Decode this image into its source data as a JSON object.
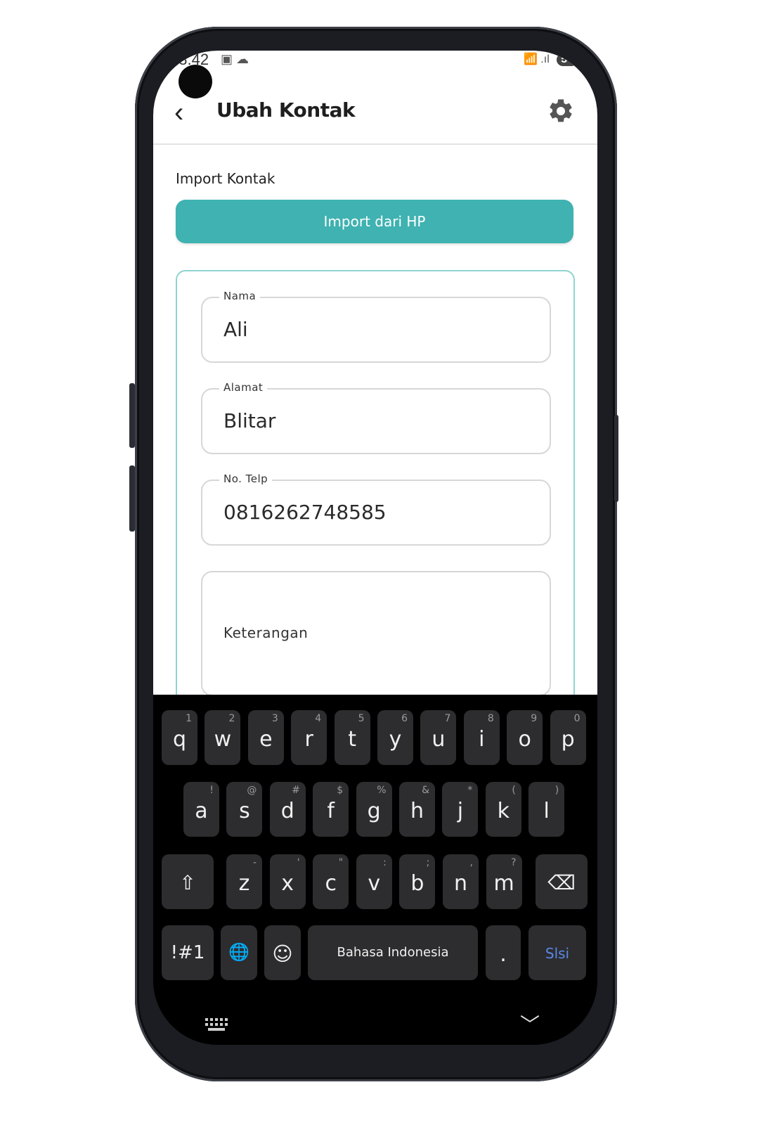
{
  "status_bar": {
    "time": "08.42",
    "left_icons": "▣ ☁",
    "right_icons": "📶 .ıl",
    "battery": "54"
  },
  "header": {
    "back_icon": "back-arrow-icon",
    "back_glyph": "‹",
    "title": "Ubah Kontak",
    "settings_icon": "gear-icon"
  },
  "import": {
    "section_label": "Import Kontak",
    "button_label": "Import dari HP",
    "button_color": "#3fb2b1"
  },
  "form": {
    "name": {
      "label": "Nama",
      "value": "Ali"
    },
    "address": {
      "label": "Alamat",
      "value": "Blitar"
    },
    "phone": {
      "label": "No. Telp",
      "value": "0816262748585"
    },
    "notes": {
      "placeholder": "Keterangan"
    },
    "card_border_color": "#8fd3d1"
  },
  "keyboard": {
    "row1": [
      {
        "k": "q",
        "s": "1"
      },
      {
        "k": "w",
        "s": "2"
      },
      {
        "k": "e",
        "s": "3"
      },
      {
        "k": "r",
        "s": "4"
      },
      {
        "k": "t",
        "s": "5"
      },
      {
        "k": "y",
        "s": "6"
      },
      {
        "k": "u",
        "s": "7"
      },
      {
        "k": "i",
        "s": "8"
      },
      {
        "k": "o",
        "s": "9"
      },
      {
        "k": "p",
        "s": "0"
      }
    ],
    "row2": [
      {
        "k": "a",
        "s": "!"
      },
      {
        "k": "s",
        "s": "@"
      },
      {
        "k": "d",
        "s": "#"
      },
      {
        "k": "f",
        "s": "$"
      },
      {
        "k": "g",
        "s": "%"
      },
      {
        "k": "h",
        "s": "&"
      },
      {
        "k": "j",
        "s": "*"
      },
      {
        "k": "k",
        "s": "("
      },
      {
        "k": "l",
        "s": ")"
      }
    ],
    "row3": [
      {
        "k": "z",
        "s": "-"
      },
      {
        "k": "x",
        "s": "'"
      },
      {
        "k": "c",
        "s": "\""
      },
      {
        "k": "v",
        "s": ":"
      },
      {
        "k": "b",
        "s": ";"
      },
      {
        "k": "n",
        "s": ","
      },
      {
        "k": "m",
        "s": "?"
      }
    ],
    "shift_glyph": "⇧",
    "backspace_glyph": "⌫",
    "symbols_label": "!#1",
    "globe_glyph": "🌐",
    "emoji_glyph": "☺",
    "space_label": "Bahasa Indonesia",
    "period_label": ".",
    "done_label": "Slsi",
    "done_color": "#5b87e8",
    "nav_down_glyph": "﹀"
  }
}
